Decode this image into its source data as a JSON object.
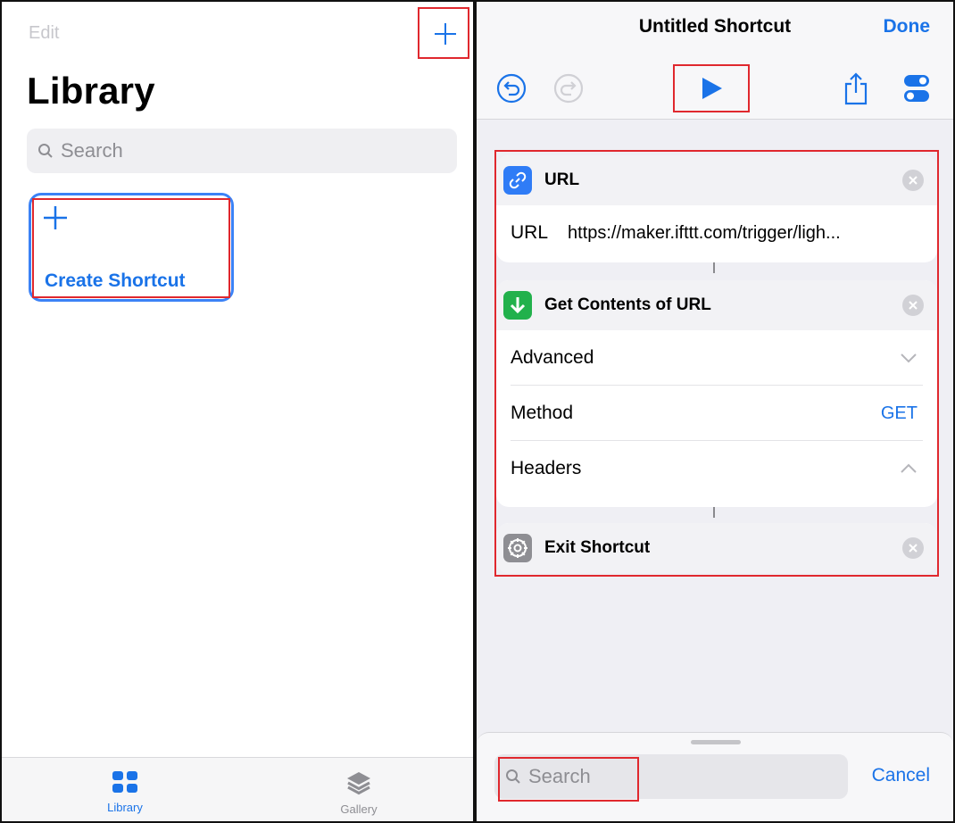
{
  "library_panel": {
    "edit_label": "Edit",
    "title": "Library",
    "search_placeholder": "Search",
    "create_card": {
      "label": "Create Shortcut"
    },
    "tabs": [
      {
        "label": "Library",
        "icon": "grid-icon",
        "active": true
      },
      {
        "label": "Gallery",
        "icon": "layers-icon",
        "active": false
      }
    ]
  },
  "editor_panel": {
    "title": "Untitled Shortcut",
    "done_label": "Done",
    "toolbar_icons": [
      "undo-icon",
      "redo-icon",
      "play-icon",
      "share-icon",
      "settings-toggle-icon"
    ],
    "actions": [
      {
        "name": "URL",
        "icon": "link-icon",
        "rows": [
          {
            "label": "URL",
            "value": "https://maker.ifttt.com/trigger/ligh..."
          }
        ]
      },
      {
        "name": "Get Contents of URL",
        "icon": "download-arrow-icon",
        "rows": [
          {
            "label": "Advanced",
            "value_icon": "chevron-down-icon"
          },
          {
            "label": "Method",
            "value": "GET"
          },
          {
            "label": "Headers",
            "value_icon": "chevron-up-icon"
          }
        ]
      },
      {
        "name": "Exit Shortcut",
        "icon": "gear-icon",
        "rows": []
      }
    ],
    "search_placeholder": "Search",
    "cancel_label": "Cancel"
  },
  "colors": {
    "accent": "#1a73e8",
    "highlight_box": "#e0282e",
    "link_icon_bg": "#2f7cf6",
    "download_icon_bg": "#22b14c",
    "gear_icon_bg": "#8e8e93"
  }
}
